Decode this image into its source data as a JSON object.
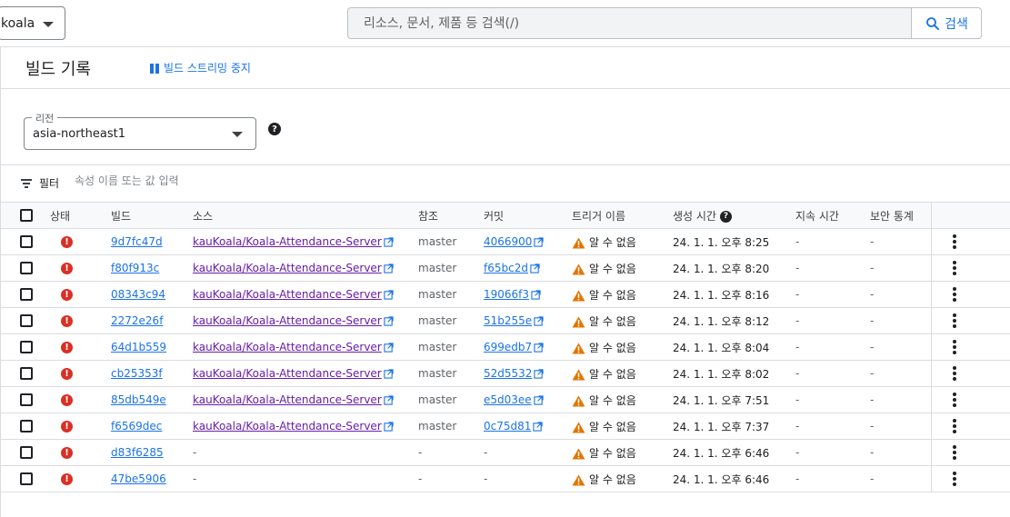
{
  "topbar": {
    "project": "koala",
    "search_placeholder": "리소스, 문서, 제품 등 검색(/)",
    "search_button": "검색"
  },
  "page": {
    "title": "빌드 기록",
    "stop_streaming": "빌드 스트리밍 중지"
  },
  "region": {
    "label": "리전",
    "value": "asia-northeast1"
  },
  "filter": {
    "label": "필터",
    "placeholder": "속성 이름 또는 값 입력"
  },
  "table": {
    "headers": {
      "status": "상태",
      "build": "빌드",
      "source": "소스",
      "ref": "참조",
      "commit": "커밋",
      "trigger": "트리거 이름",
      "created": "생성 시간",
      "duration": "지속 시간",
      "security": "보안 통계"
    },
    "rows": [
      {
        "build": "9d7fc47d",
        "source": "kauKoala/Koala-Attendance-Server",
        "ref": "master",
        "commit": "4066900",
        "trigger": "알 수 없음",
        "created": "24. 1. 1. 오후 8:25",
        "duration": "-",
        "security": "-"
      },
      {
        "build": "f80f913c",
        "source": "kauKoala/Koala-Attendance-Server",
        "ref": "master",
        "commit": "f65bc2d",
        "trigger": "알 수 없음",
        "created": "24. 1. 1. 오후 8:20",
        "duration": "-",
        "security": "-"
      },
      {
        "build": "08343c94",
        "source": "kauKoala/Koala-Attendance-Server",
        "ref": "master",
        "commit": "19066f3",
        "trigger": "알 수 없음",
        "created": "24. 1. 1. 오후 8:16",
        "duration": "-",
        "security": "-"
      },
      {
        "build": "2272e26f",
        "source": "kauKoala/Koala-Attendance-Server",
        "ref": "master",
        "commit": "51b255e",
        "trigger": "알 수 없음",
        "created": "24. 1. 1. 오후 8:12",
        "duration": "-",
        "security": "-"
      },
      {
        "build": "64d1b559",
        "source": "kauKoala/Koala-Attendance-Server",
        "ref": "master",
        "commit": "699edb7",
        "trigger": "알 수 없음",
        "created": "24. 1. 1. 오후 8:04",
        "duration": "-",
        "security": "-"
      },
      {
        "build": "cb25353f",
        "source": "kauKoala/Koala-Attendance-Server",
        "ref": "master",
        "commit": "52d5532",
        "trigger": "알 수 없음",
        "created": "24. 1. 1. 오후 8:02",
        "duration": "-",
        "security": "-"
      },
      {
        "build": "85db549e",
        "source": "kauKoala/Koala-Attendance-Server",
        "ref": "master",
        "commit": "e5d03ee",
        "trigger": "알 수 없음",
        "created": "24. 1. 1. 오후 7:51",
        "duration": "-",
        "security": "-"
      },
      {
        "build": "f6569dec",
        "source": "kauKoala/Koala-Attendance-Server",
        "ref": "master",
        "commit": "0c75d81",
        "trigger": "알 수 없음",
        "created": "24. 1. 1. 오후 7:37",
        "duration": "-",
        "security": "-"
      },
      {
        "build": "d83f6285",
        "source": "-",
        "ref": "-",
        "commit": "-",
        "trigger": "알 수 없음",
        "created": "24. 1. 1. 오후 6:46",
        "duration": "-",
        "security": "-"
      },
      {
        "build": "47be5906",
        "source": "-",
        "ref": "-",
        "commit": "-",
        "trigger": "알 수 없음",
        "created": "24. 1. 1. 오후 6:46",
        "duration": "-",
        "security": "-"
      }
    ]
  },
  "icons": {
    "status": "error-icon",
    "trigger": "warning-icon",
    "link": "external-link-icon",
    "menu": "more-vert-icon"
  },
  "colors": {
    "accent": "#1a73e8",
    "error": "#d93025",
    "warning": "#e37400",
    "visited_link": "#681da8"
  }
}
